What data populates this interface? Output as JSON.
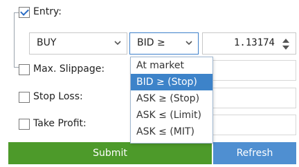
{
  "entry": {
    "checked": true,
    "label": "Entry:",
    "side_value": "BUY",
    "condition_value": "BID ≥",
    "price_value": "1.13174"
  },
  "dropdown": {
    "options": [
      "At market",
      "BID ≥ (Stop)",
      "ASK ≥ (Stop)",
      "ASK ≤ (Limit)",
      "ASK ≤ (MIT)"
    ],
    "selected_index": 1
  },
  "options": {
    "max_slippage_label": "Max. Slippage:",
    "stop_loss_label": "Stop Loss:",
    "take_profit_label": "Take Profit:"
  },
  "buttons": {
    "submit_label": "Submit",
    "refresh_label": "Refresh"
  },
  "colors": {
    "submit": "#4d9a2a",
    "refresh": "#4f8fd1",
    "selected_option": "#3d83c9"
  }
}
